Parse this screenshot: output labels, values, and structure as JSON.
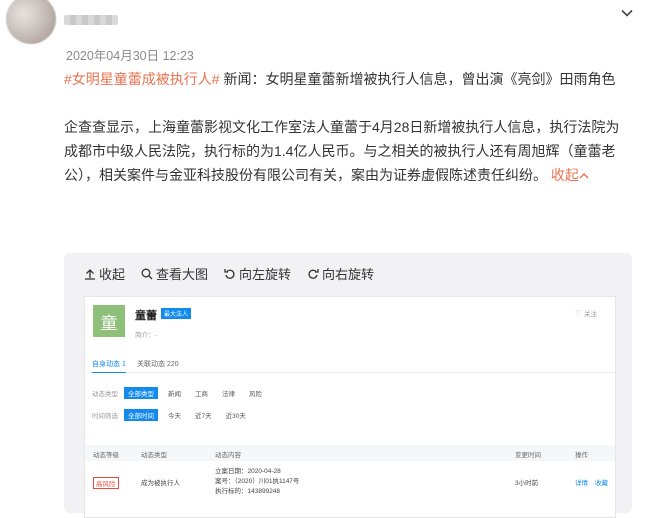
{
  "post": {
    "timestamp": "2020年04月30日 12:23",
    "hashtag": "#女明星童蕾成被执行人#",
    "intro": " 新闻：女明星童蕾新增被执行人信息，曾出演《亮剑》田雨角色",
    "body": "企查查显示，上海童蕾影视文化工作室法人童蕾于4月28日新增被执行人信息，执行法院为成都市中级人民法院，执行标的为1.4亿人民币。与之相关的被执行人还有周旭辉（童蕾老公），相关案件与金亚科技股份有限公司有关，案由为证券虚假陈述责任纠纷。",
    "collapse": "收起"
  },
  "viewer": {
    "toolbar": [
      "收起",
      "查看大图",
      "向左旋转",
      "向右旋转"
    ]
  },
  "card": {
    "logo": "童",
    "name": "童蕾",
    "tag": "最大法人",
    "sub": "简介：-",
    "follow": "关注",
    "tabs": [
      "自身动态 1",
      "关联动态 220"
    ],
    "filter1_label": "动态类型",
    "filter1": [
      "全部类型",
      "新闻",
      "工商",
      "法律",
      "风险"
    ],
    "filter2_label": "时间筛选",
    "filter2": [
      "全部时间",
      "今天",
      "近7天",
      "近30天"
    ],
    "headers": [
      "动态等级",
      "动态类型",
      "动态内容",
      "变更时间",
      "操作"
    ],
    "row": {
      "level": "高风险",
      "type": "成为被执行人",
      "content": [
        "立案日期：2020-04-28",
        "案号：（2020）川01执1147号",
        "执行标的：143899248"
      ],
      "time": "3小时前",
      "ops": [
        "详情",
        "收藏"
      ]
    }
  }
}
